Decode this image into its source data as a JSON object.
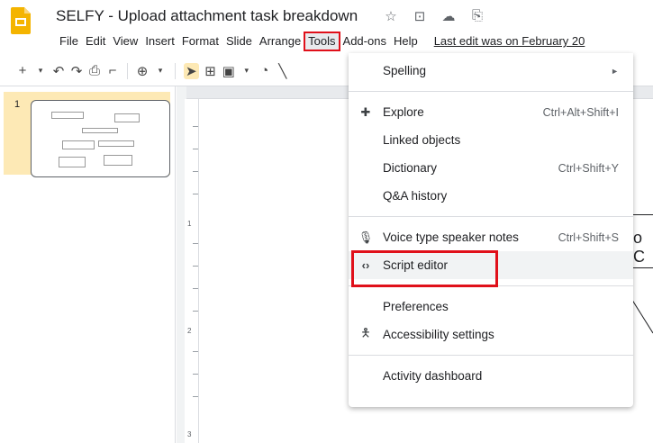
{
  "app": {
    "title": "SELFY - Upload attachment task breakdown",
    "last_edit": "Last edit was on February 20"
  },
  "menubar": {
    "items": [
      "File",
      "Edit",
      "View",
      "Insert",
      "Format",
      "Slide",
      "Arrange",
      "Tools",
      "Add-ons",
      "Help"
    ],
    "active": "Tools"
  },
  "filmstrip": {
    "slide_number": "1"
  },
  "ruler": {
    "marks": [
      "1",
      "2",
      "3"
    ]
  },
  "slide": {
    "partial_text": "o C"
  },
  "tools_menu": {
    "spelling": "Spelling",
    "explore": "Explore",
    "explore_shortcut": "Ctrl+Alt+Shift+I",
    "linked_objects": "Linked objects",
    "dictionary": "Dictionary",
    "dictionary_shortcut": "Ctrl+Shift+Y",
    "qa_history": "Q&A history",
    "voice_type": "Voice type speaker notes",
    "voice_type_shortcut": "Ctrl+Shift+S",
    "script_editor": "Script editor",
    "preferences": "Preferences",
    "accessibility": "Accessibility settings",
    "activity_dashboard": "Activity dashboard"
  },
  "colors": {
    "accent_yellow": "#fde9b5",
    "highlight_red": "#e0101a",
    "slides_logo": "#f4b400"
  }
}
